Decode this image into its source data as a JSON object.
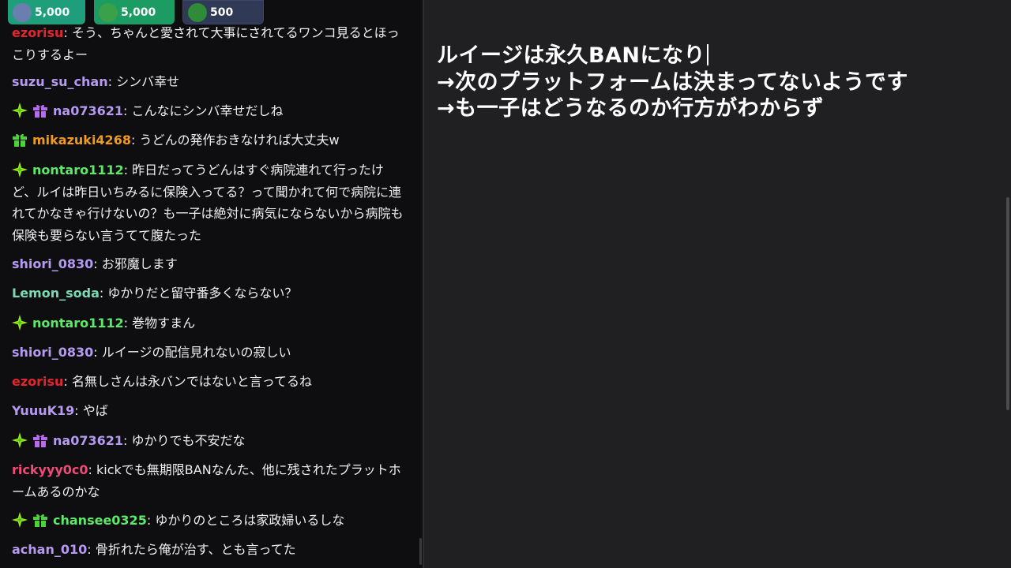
{
  "leaderboard": [
    {
      "value": "5,000",
      "color": "#1f9e7c",
      "avatar_color": "#6a7fae"
    },
    {
      "value": "5,000",
      "color": "#1c9b63",
      "avatar_color": "#3aa14a"
    },
    {
      "value": "500",
      "color": "#303a56",
      "avatar_color": "#2f8a3a"
    }
  ],
  "chat": {
    "messages": [
      {
        "user": "ezorisu",
        "user_color": "#e0262e",
        "text": "そう、ちゃんと愛されて大事にされてるワンコ見るとほっこりするよー",
        "badges": []
      },
      {
        "user": "suzu_su_chan",
        "user_color": "#b59bf0",
        "text": "シンバ幸せ",
        "badges": []
      },
      {
        "user": "na073621",
        "user_color": "#b59bf0",
        "text": "こんなにシンバ幸せだしね",
        "badges": [
          "sparkle",
          "gift-purple"
        ]
      },
      {
        "user": "mikazuki4268",
        "user_color": "#f09a1e",
        "text": "うどんの発作おきなければ大丈夫w",
        "badges": [
          "gift-green"
        ]
      },
      {
        "user": "nontaro1112",
        "user_color": "#5ee86a",
        "text": "昨日だってうどんはすぐ病院連れて行ったけど、ルイは昨日いちみるに保険入ってる？って聞かれて何で病院に連れてかなきゃ行けないの？も一子は絶対に病気にならないから病院も保険も要らない言うてて腹たった",
        "badges": [
          "sparkle"
        ]
      },
      {
        "user": "shiori_0830",
        "user_color": "#b59bf0",
        "text": "お邪魔します",
        "badges": []
      },
      {
        "user": "Lemon_soda",
        "user_color": "#7ad9b3",
        "text": "ゆかりだと留守番多くならない？",
        "badges": []
      },
      {
        "user": "nontaro1112",
        "user_color": "#5ee86a",
        "text": "巻物すまん",
        "badges": [
          "sparkle"
        ]
      },
      {
        "user": "shiori_0830",
        "user_color": "#b59bf0",
        "text": "ルイージの配信見れないの寂しい",
        "badges": []
      },
      {
        "user": "ezorisu",
        "user_color": "#e0262e",
        "text": "名無しさんは永バンではないと言ってるね",
        "badges": []
      },
      {
        "user": "YuuuK19",
        "user_color": "#b59bf0",
        "text": "やば",
        "badges": []
      },
      {
        "user": "na073621",
        "user_color": "#b59bf0",
        "text": "ゆかりでも不安だな",
        "badges": [
          "sparkle",
          "gift-purple"
        ]
      },
      {
        "user": "rickyyy0c0",
        "user_color": "#f04a7a",
        "text": "kickでも無期限BANなんた、他に残されたプラットホームあるのかな",
        "badges": []
      },
      {
        "user": "chansee0325",
        "user_color": "#5ee86a",
        "text": "ゆかりのところは家政婦いるしな",
        "badges": [
          "sparkle",
          "gift-green"
        ]
      },
      {
        "user": "achan_010",
        "user_color": "#b59bf0",
        "text": "骨折れたら俺が治す、とも言ってた",
        "badges": []
      }
    ]
  },
  "notes": {
    "lines": [
      "ルイージは永久BANになり",
      "→次のプラットフォームは決まってないようです",
      "→も一子はどうなるのか行方がわからず"
    ]
  }
}
